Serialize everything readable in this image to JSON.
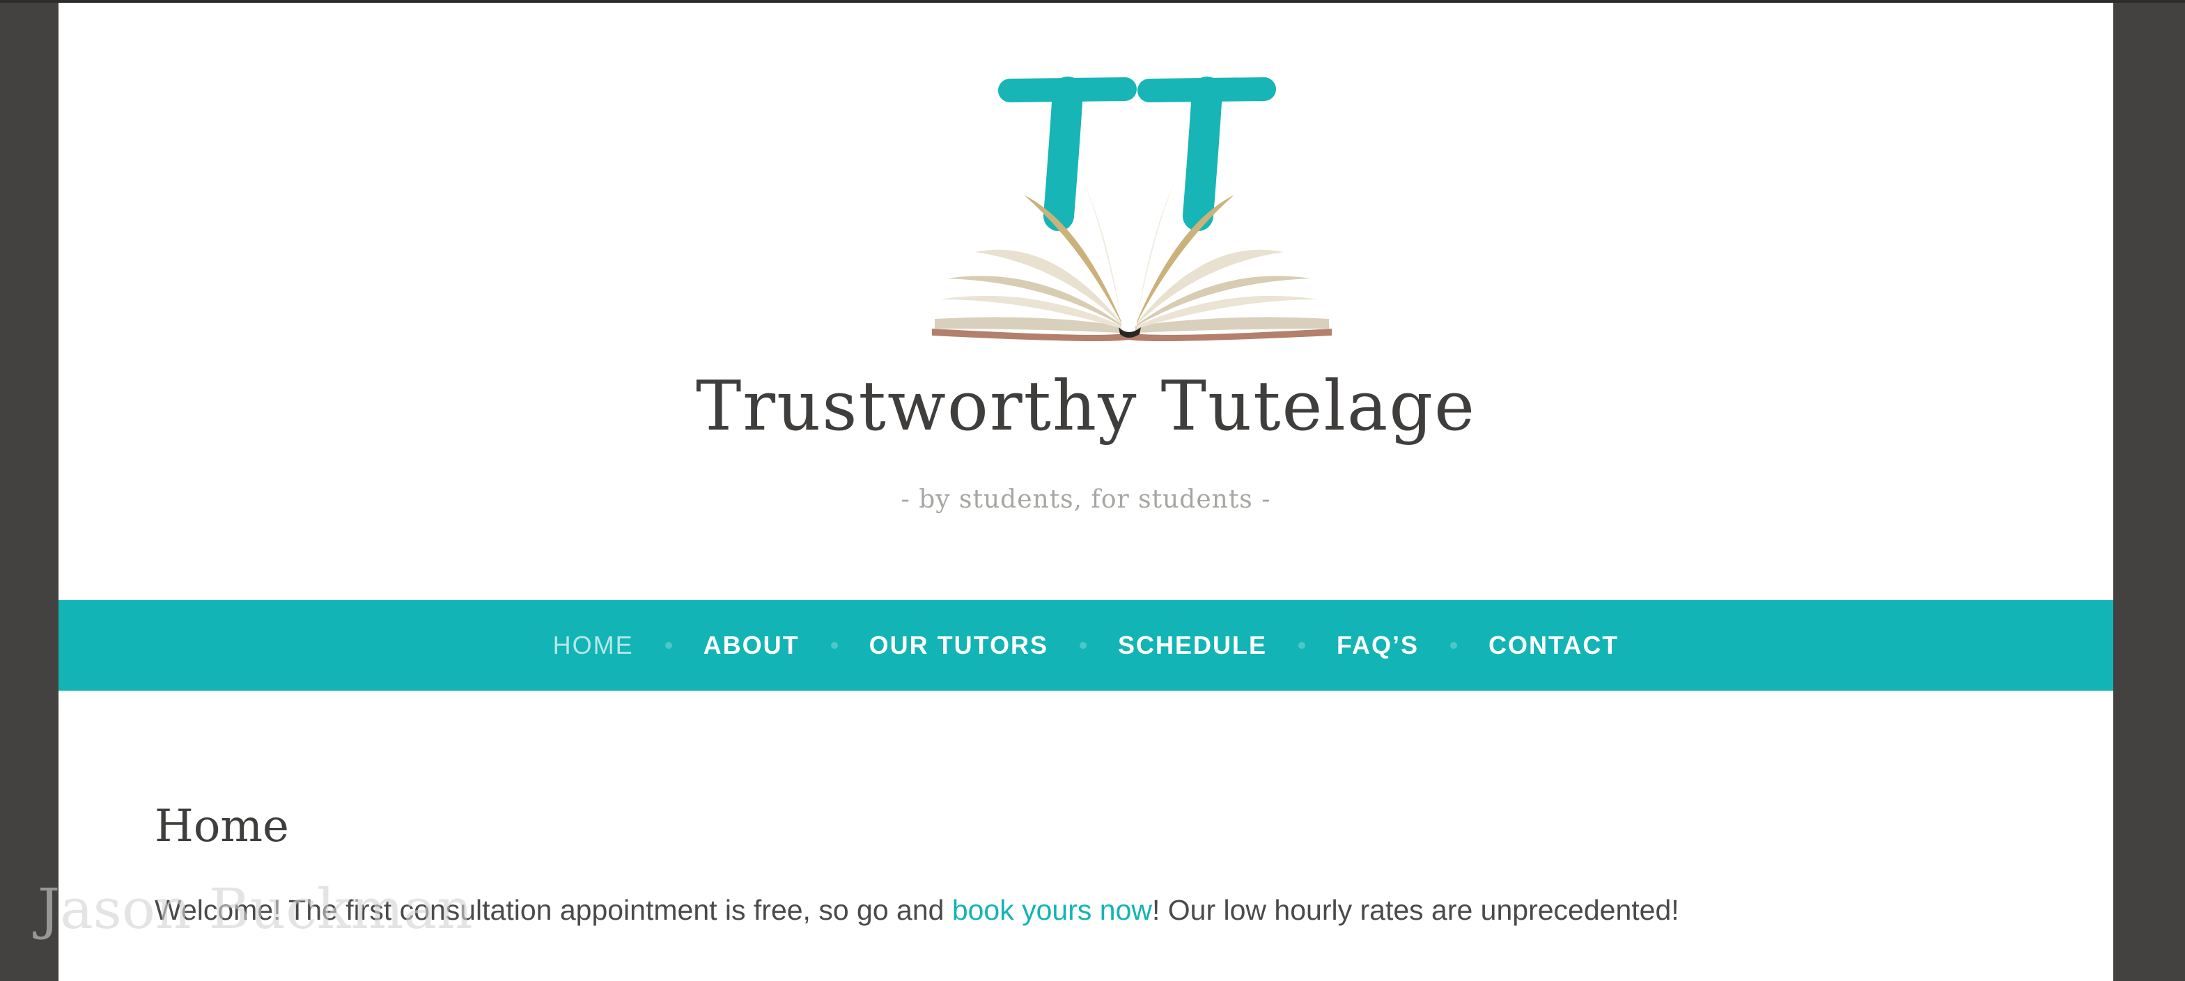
{
  "site": {
    "title": "Trustworthy Tutelage",
    "tagline": "- by students, for students -",
    "logo_letters": "TT"
  },
  "nav": {
    "items": [
      {
        "label": "HOME",
        "active": true
      },
      {
        "label": "ABOUT"
      },
      {
        "label": "OUR TUTORS"
      },
      {
        "label": "SCHEDULE"
      },
      {
        "label": "FAQ’S"
      },
      {
        "label": "CONTACT"
      }
    ]
  },
  "content": {
    "heading": "Home",
    "text_before": "Welcome! The first consultation appointment is free, so go and ",
    "link_text": "book yours now",
    "text_after": "! Our low hourly rates are unprecedented!"
  },
  "watermark": "Jason Buckman",
  "colors": {
    "accent": "#13b4b5",
    "background": "#434240",
    "page": "#ffffff",
    "text": "#3f3e3c",
    "muted": "#a7a6a2"
  }
}
